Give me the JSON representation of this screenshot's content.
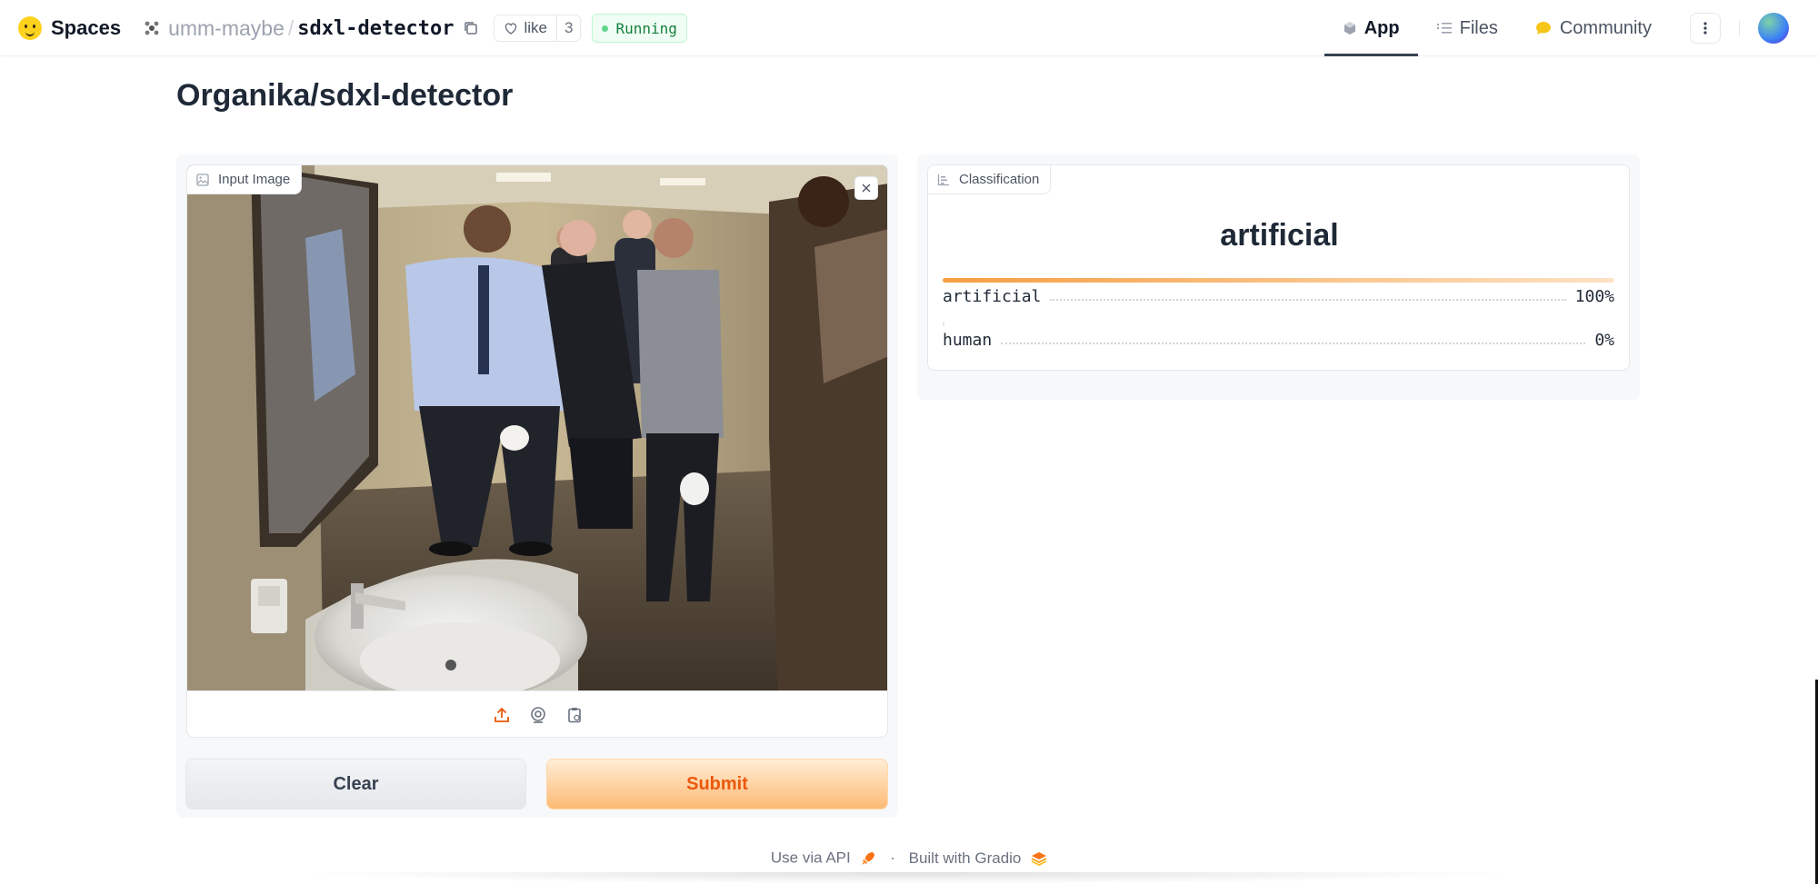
{
  "topbar": {
    "brand": "Spaces",
    "owner": "umm-maybe",
    "repo": "sdxl-detector",
    "like_label": "like",
    "like_count": "3",
    "status": "Running",
    "nav": [
      {
        "label": "App",
        "icon": "app-cube-icon",
        "active": true
      },
      {
        "label": "Files",
        "icon": "files-icon",
        "active": false
      },
      {
        "label": "Community",
        "icon": "community-icon",
        "active": false
      }
    ]
  },
  "page": {
    "title": "Organika/sdxl-detector"
  },
  "input_image": {
    "label": "Input Image",
    "tools": [
      "upload-icon",
      "webcam-icon",
      "clipboard-icon"
    ]
  },
  "buttons": {
    "clear": "Clear",
    "submit": "Submit"
  },
  "classification": {
    "label": "Classification",
    "top_label": "artificial",
    "confidences": [
      {
        "label": "artificial",
        "value": "100%",
        "fraction": 1.0
      },
      {
        "label": "human",
        "value": "0%",
        "fraction": 0.0
      }
    ]
  },
  "footer": {
    "api": "Use via API",
    "separator": "·",
    "built": "Built with Gradio"
  },
  "colors": {
    "accent": "#ea580c",
    "status_green": "#15803d"
  }
}
